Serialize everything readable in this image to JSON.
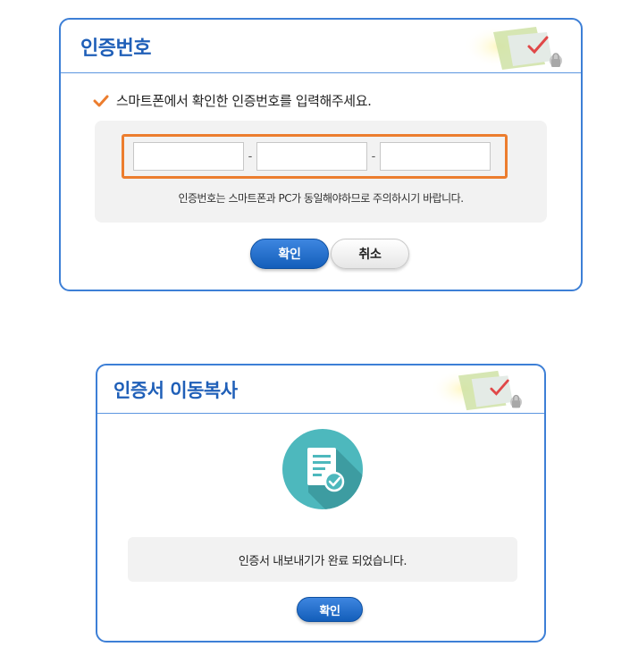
{
  "verification_dialog": {
    "title": "인증번호",
    "instruction": "스마트폰에서 확인한 인증번호를 입력해주세요.",
    "inputs": [
      {
        "value": "",
        "placeholder": ""
      },
      {
        "value": "",
        "placeholder": ""
      },
      {
        "value": "",
        "placeholder": ""
      }
    ],
    "separator": "-",
    "note": "인증번호는 스마트폰과 PC가 동일해야하므로 주의하시기 바랍니다.",
    "confirm_label": "확인",
    "cancel_label": "취소"
  },
  "transfer_dialog": {
    "title": "인증서 이동복사",
    "message": "인증서 내보내기가 완료 되었습니다.",
    "confirm_label": "확인",
    "icon": "document-check-icon"
  },
  "colors": {
    "accent_blue": "#1f5fb8",
    "border_blue": "#3d7fd6",
    "highlight_orange": "#ec7d2e",
    "icon_teal": "#4db8bd"
  }
}
